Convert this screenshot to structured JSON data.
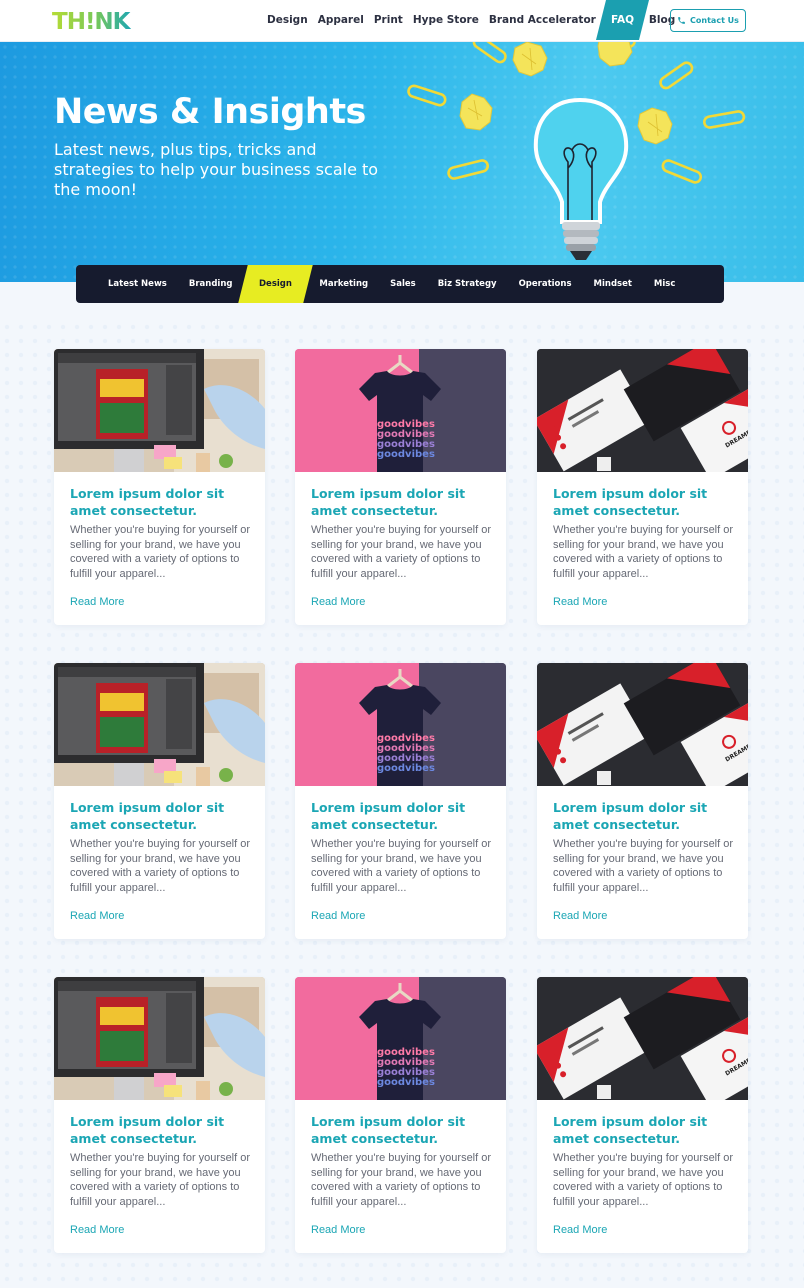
{
  "header": {
    "logo": "TH!NK",
    "nav": [
      "Design",
      "Apparel",
      "Print",
      "Hype Store",
      "Brand Accelerator",
      "FAQ",
      "Blog"
    ],
    "active_nav": "FAQ",
    "contact_label": "Contact Us"
  },
  "hero": {
    "title": "News & Insights",
    "subtitle": "Latest news, plus tips, tricks and strategies to help your business scale to the moon!"
  },
  "categories": [
    "Latest News",
    "Branding",
    "Design",
    "Marketing",
    "Sales",
    "Biz Strategy",
    "Operations",
    "Mindset",
    "Misc"
  ],
  "active_category": "Design",
  "posts": [
    {
      "image": "monitor-design-image",
      "title": "Lorem ipsum dolor sit amet consectetur.",
      "excerpt": "Whether you're buying for yourself or selling for your brand, we have you covered with a variety of options to fulfill your apparel...",
      "link": "Read More"
    },
    {
      "image": "tshirt-image",
      "title": "Lorem ipsum dolor sit amet consectetur.",
      "excerpt": "Whether you're buying for yourself or selling for your brand, we have you covered with a variety of options to fulfill your apparel...",
      "link": "Read More"
    },
    {
      "image": "business-cards-image",
      "title": "Lorem ipsum dolor sit amet consectetur.",
      "excerpt": "Whether you're buying for yourself or selling for your brand, we have you covered with a variety of options to fulfill your apparel...",
      "link": "Read More"
    },
    {
      "image": "monitor-design-image",
      "title": "Lorem ipsum dolor sit amet consectetur.",
      "excerpt": "Whether you're buying for yourself or selling for your brand, we have you covered with a variety of options to fulfill your apparel...",
      "link": "Read More"
    },
    {
      "image": "tshirt-image",
      "title": "Lorem ipsum dolor sit amet consectetur.",
      "excerpt": "Whether you're buying for yourself or selling for your brand, we have you covered with a variety of options to fulfill your apparel...",
      "link": "Read More"
    },
    {
      "image": "business-cards-image",
      "title": "Lorem ipsum dolor sit amet consectetur.",
      "excerpt": "Whether you're buying for yourself or selling for your brand, we have you covered with a variety of options to fulfill your apparel...",
      "link": "Read More"
    },
    {
      "image": "monitor-design-image",
      "title": "Lorem ipsum dolor sit amet consectetur.",
      "excerpt": "Whether you're buying for yourself or selling for your brand, we have you covered with a variety of options to fulfill your apparel...",
      "link": "Read More"
    },
    {
      "image": "tshirt-image",
      "title": "Lorem ipsum dolor sit amet consectetur.",
      "excerpt": "Whether you're buying for yourself or selling for your brand, we have you covered with a variety of options to fulfill your apparel...",
      "link": "Read More"
    },
    {
      "image": "business-cards-image",
      "title": "Lorem ipsum dolor sit amet consectetur.",
      "excerpt": "Whether you're buying for yourself or selling for your brand, we have you covered with a variety of options to fulfill your apparel...",
      "link": "Read More"
    }
  ],
  "colors": {
    "accent_teal": "#1b9fb0",
    "logo_green": "#a8d63c",
    "logo_teal": "#1ba6b4",
    "highlight_yellow": "#e7ec22",
    "dark_navy": "#161b2e",
    "hero_blue": "#2bb5ea"
  }
}
